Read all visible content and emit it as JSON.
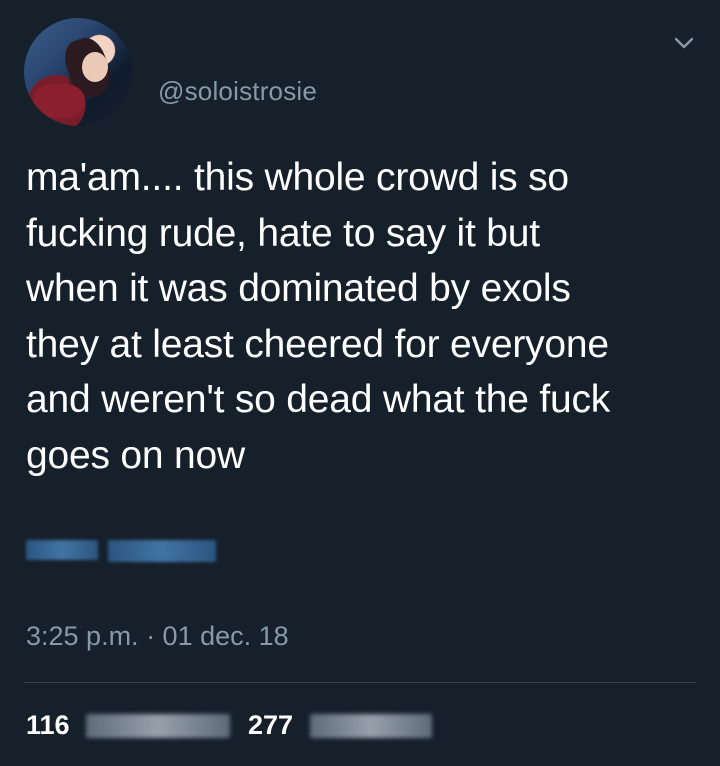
{
  "tweet": {
    "handle": "@soloistrosie",
    "text": "ma'am.... this whole crowd is so\nfucking rude, hate to say it but\nwhen it was dominated by exols\nthey at least cheered for everyone\nand weren't so dead what the fuck\ngoes on now",
    "timestamp": "3:25 p.m. · 01 dec. 18",
    "stats": {
      "retweets_count": "116",
      "likes_count": "277"
    }
  },
  "icons": {
    "menu": "chevron-down-icon"
  },
  "colors": {
    "background": "#15202b",
    "text": "#ffffff",
    "muted": "#8899a6",
    "divider": "#38444d"
  }
}
